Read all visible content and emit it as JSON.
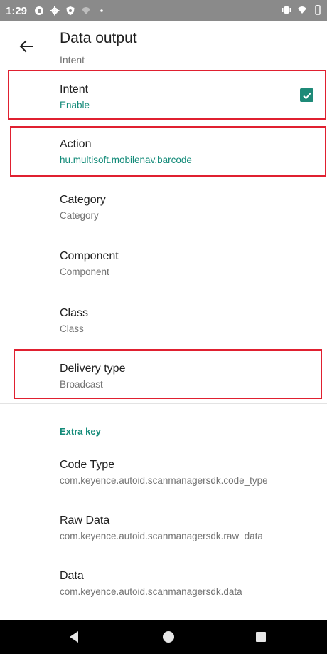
{
  "status_bar": {
    "time": "1:29",
    "left_icons": [
      "g-icon",
      "gear-icon",
      "shield-icon",
      "wifi-icon",
      "dot-icon"
    ],
    "right_icons": [
      "vibrate-icon",
      "wifi-icon",
      "battery-icon"
    ]
  },
  "app_bar": {
    "title": "Data output",
    "subtitle": "Intent"
  },
  "preferences": [
    {
      "id": "intent",
      "title": "Intent",
      "summary": "Enable",
      "accent": true,
      "checked": true
    },
    {
      "id": "action",
      "title": "Action",
      "summary": "hu.multisoft.mobilenav.barcode",
      "accent": true
    },
    {
      "id": "category",
      "title": "Category",
      "summary": "Category"
    },
    {
      "id": "component",
      "title": "Component",
      "summary": "Component"
    },
    {
      "id": "class",
      "title": "Class",
      "summary": "Class"
    },
    {
      "id": "delivery-type",
      "title": "Delivery type",
      "summary": "Broadcast"
    }
  ],
  "section": {
    "header": "Extra key",
    "items": [
      {
        "title": "Code Type",
        "summary": "com.keyence.autoid.scanmanagersdk.code_type"
      },
      {
        "title": "Raw Data",
        "summary": "com.keyence.autoid.scanmanagersdk.raw_data"
      },
      {
        "title": "Data",
        "summary": "com.keyence.autoid.scanmanagersdk.data"
      }
    ]
  },
  "colors": {
    "accent": "#128a78",
    "highlight": "#e02030",
    "status_bar": "#8a8a8a"
  }
}
